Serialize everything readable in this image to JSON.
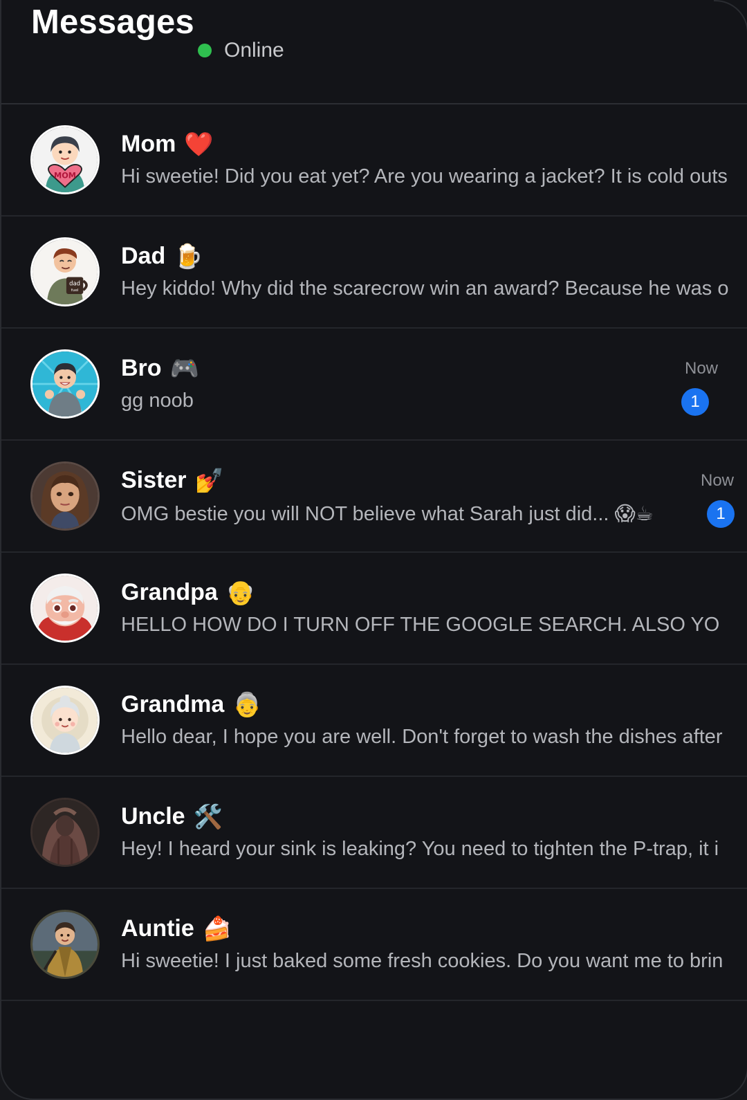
{
  "header": {
    "title": "Messages",
    "status": "Online",
    "status_color": "#2fbf4f"
  },
  "contacts": [
    {
      "name": "Mom",
      "emoji": "❤️",
      "preview": "Hi sweetie! Did you eat yet? Are you wearing a jacket? It is cold outs",
      "avatar_icon": "mom-heart-avatar"
    },
    {
      "name": "Dad",
      "emoji": "🍺",
      "preview": "Hey kiddo! Why did the scarecrow win an award? Because he was o",
      "avatar_icon": "dad-mug-avatar"
    },
    {
      "name": "Bro",
      "emoji": "🎮",
      "preview": "gg noob",
      "time": "Now",
      "unread": "1",
      "avatar_icon": "bro-gamer-avatar"
    },
    {
      "name": "Sister",
      "emoji": "💅",
      "preview": "OMG bestie you will NOT believe what Sarah just did... 😱☕",
      "time": "Now",
      "unread": "1",
      "avatar_icon": "sister-avatar"
    },
    {
      "name": "Grandpa",
      "emoji": "👴",
      "preview": "HELLO HOW DO I TURN OFF THE GOOGLE SEARCH. ALSO YO",
      "avatar_icon": "grandpa-avatar"
    },
    {
      "name": "Grandma",
      "emoji": "👵",
      "preview": "Hello dear, I hope you are well. Don't forget to wash the dishes after",
      "avatar_icon": "grandma-avatar"
    },
    {
      "name": "Uncle",
      "emoji": "🛠️",
      "preview": "Hey! I heard your sink is leaking? You need to tighten the P-trap, it i",
      "avatar_icon": "uncle-avatar"
    },
    {
      "name": "Auntie",
      "emoji": "🍰",
      "preview": "Hi sweetie! I just baked some fresh cookies. Do you want me to brin",
      "avatar_icon": "auntie-avatar"
    }
  ],
  "colors": {
    "background": "#131418",
    "unread_badge": "#1a73f0",
    "divider": "#24262b"
  }
}
